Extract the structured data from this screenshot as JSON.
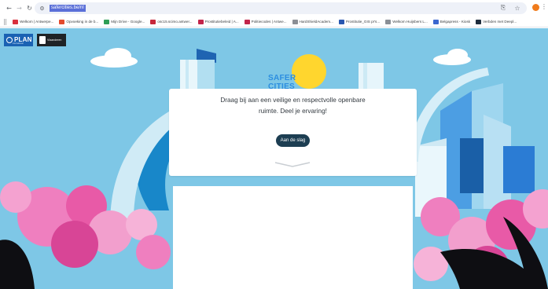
{
  "browser": {
    "url": "safercities.be/nl",
    "bookmarks": [
      {
        "label": "Welkom | Antwerpe...",
        "color": "#d9303d"
      },
      {
        "label": "Opvoeking in de b...",
        "color": "#e34a2c"
      },
      {
        "label": "Mijn Drive - Google...",
        "color": "#2f9e55"
      },
      {
        "label": "osc15.scimo.antwer...",
        "color": "#c7273a"
      },
      {
        "label": "Prostitutiebeleid | A...",
        "color": "#c2254a"
      },
      {
        "label": "Politiecodes | Antwe...",
        "color": "#c2254a"
      },
      {
        "label": "HardShieldAcadem...",
        "color": "#8b8f95"
      },
      {
        "label": "Prostitutie_GIS pr's...",
        "color": "#2857b0"
      },
      {
        "label": "Welkom Huijsbers L...",
        "color": "#8a8f96"
      },
      {
        "label": "Belgapress - Kiosk",
        "color": "#3b67cf"
      },
      {
        "label": "Verbden met Deepl...",
        "color": "#1f2d3d"
      }
    ]
  },
  "header": {
    "plan_label": "PLAN",
    "plan_sub": "international",
    "partner_label": "Vlaanderen"
  },
  "brand": {
    "name": "SAFER CITIES"
  },
  "card": {
    "intro": "Draag bij aan een veilige en respectvolle openbare ruimte. Deel je ervaring!",
    "cta_label": "Aan de slag"
  },
  "colors": {
    "sky": "#7ec7e6",
    "cta": "#1d3e52",
    "brand": "#2c8ee0",
    "sun": "#ffd62e",
    "pink": "#ef7fbf"
  },
  "icons": [
    "back-icon",
    "forward-icon",
    "reload-icon",
    "site-info-icon",
    "translate-icon",
    "bookmark-star-icon",
    "extension-icon",
    "menu-icon",
    "apps-icon",
    "chevron-down-icon"
  ]
}
